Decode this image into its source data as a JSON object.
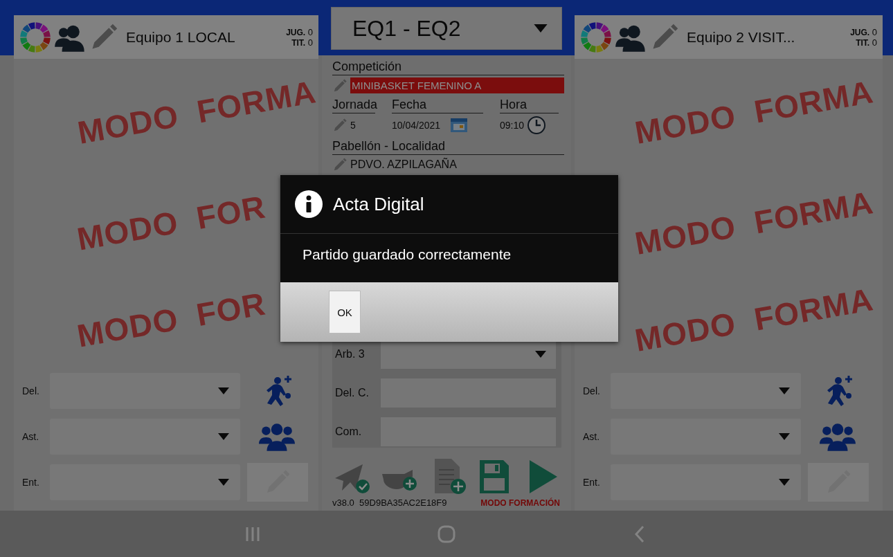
{
  "home_team": {
    "name": "Equipo 1 LOCAL",
    "players_label": "JUG.",
    "players": "0",
    "starters_label": "TIT.",
    "starters": "0",
    "watermarks": [
      "MODO FORMA",
      "MODO FOR",
      "MODO FOR"
    ],
    "staff": [
      {
        "label": "Del.",
        "kind": "add-player"
      },
      {
        "label": "Ast.",
        "kind": "group"
      },
      {
        "label": "Ent.",
        "kind": "edit"
      }
    ]
  },
  "match": {
    "selector": "EQ1 - EQ2",
    "competition": {
      "label": "Competición",
      "value": "MINIBASKET FEMENINO A"
    },
    "round": {
      "label": "Jornada",
      "value": "5"
    },
    "date": {
      "label": "Fecha",
      "value": "10/04/2021"
    },
    "time": {
      "label": "Hora",
      "value": "09:10"
    },
    "venue": {
      "label": "Pabellón - Localidad",
      "value": "PDVO. AZPILAGAÑA"
    },
    "officials": [
      {
        "label": "Arb. 3",
        "kind": "dropdown"
      },
      {
        "label": "Del. C.",
        "kind": "text"
      },
      {
        "label": "Com.",
        "kind": "text"
      }
    ],
    "version": "v38.0",
    "device_id": "59D9BA35AC2E18F9",
    "mode": "MODO FORMACIÓN"
  },
  "away_team": {
    "name": "Equipo 2 VISIT...",
    "players_label": "JUG.",
    "players": "0",
    "starters_label": "TIT.",
    "starters": "0",
    "watermarks": [
      "MODO FORMA",
      "MODO FORMA",
      "MODO FORMA"
    ],
    "staff": [
      {
        "label": "Del.",
        "kind": "add-player"
      },
      {
        "label": "Ast.",
        "kind": "group"
      },
      {
        "label": "Ent.",
        "kind": "edit"
      }
    ]
  },
  "dialog": {
    "title": "Acta Digital",
    "message": "Partido guardado correctamente",
    "buttons": [
      "OK"
    ]
  }
}
